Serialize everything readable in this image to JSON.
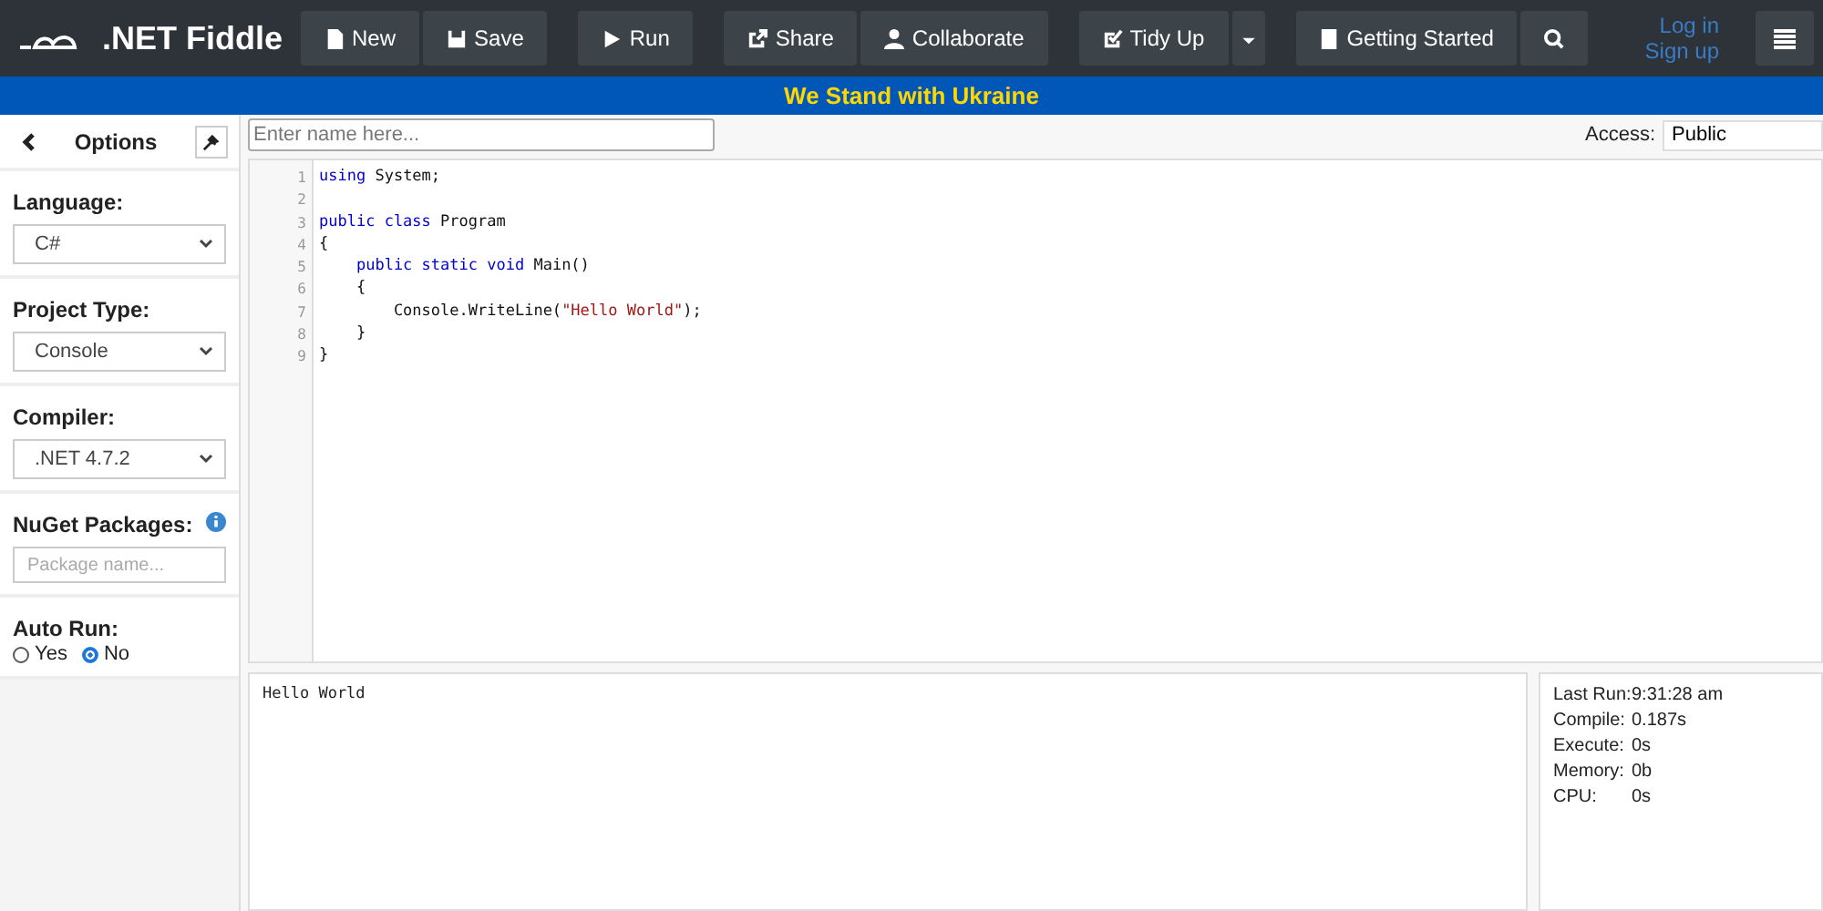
{
  "header": {
    "logo": ".NET Fiddle",
    "buttons": [
      "New",
      "Save",
      "Run",
      "Share",
      "Collaborate",
      "Tidy Up",
      "Getting Started"
    ],
    "links": [
      "Log in",
      "Sign up"
    ]
  },
  "banner": "We Stand with Ukraine",
  "sidebar": {
    "title": "Options",
    "selects": [
      {
        "label": "Language:",
        "value": "C#"
      },
      {
        "label": "Project Type:",
        "value": "Console"
      },
      {
        "label": "Compiler:",
        "value": ".NET 4.7.2"
      }
    ],
    "nuget": {
      "label": "NuGet Packages:",
      "placeholder": "Package name..."
    },
    "auto_run": {
      "label": "Auto Run:",
      "options": [
        {
          "label": "Yes",
          "selected": false
        },
        {
          "label": "No",
          "selected": true
        }
      ]
    }
  },
  "name_field": {
    "placeholder": "Enter name here..."
  },
  "access": {
    "label": "Access:",
    "value": "Public"
  },
  "code": [
    {
      "number": "1",
      "tokens": [
        {
          "kind": "keyword",
          "text": "using"
        },
        {
          "kind": "plain",
          "text": " System;"
        }
      ]
    },
    {
      "number": "2"
    },
    {
      "number": "3",
      "tokens": [
        {
          "kind": "keyword",
          "text": "public class"
        },
        {
          "kind": "plain",
          "text": " Program"
        }
      ]
    },
    {
      "number": "4",
      "tokens": [
        {
          "kind": "plain",
          "text": "{"
        }
      ]
    },
    {
      "number": "5",
      "tokens": [
        {
          "kind": "keyword",
          "text": "    public static void"
        },
        {
          "kind": "plain",
          "text": " Main()"
        }
      ]
    },
    {
      "number": "6",
      "tokens": [
        {
          "kind": "plain",
          "text": "    {"
        }
      ]
    },
    {
      "number": "7",
      "tokens": [
        {
          "kind": "plain",
          "text": "        Console.WriteLine("
        },
        {
          "kind": "string",
          "text": "\"Hello World\""
        },
        {
          "kind": "plain",
          "text": ");"
        }
      ]
    },
    {
      "number": "8",
      "tokens": [
        {
          "kind": "plain",
          "text": "    }"
        }
      ]
    },
    {
      "number": "9",
      "tokens": [
        {
          "kind": "plain",
          "text": "}"
        }
      ]
    }
  ],
  "output": "Hello World",
  "stats": [
    {
      "label": "Last Run:",
      "value": "9:31:28 am"
    },
    {
      "label": "Compile:",
      "value": "0.187s"
    },
    {
      "label": "Execute:",
      "value": "0s"
    },
    {
      "label": "Memory:",
      "value": "0b"
    },
    {
      "label": "CPU:",
      "value": "0s"
    }
  ]
}
